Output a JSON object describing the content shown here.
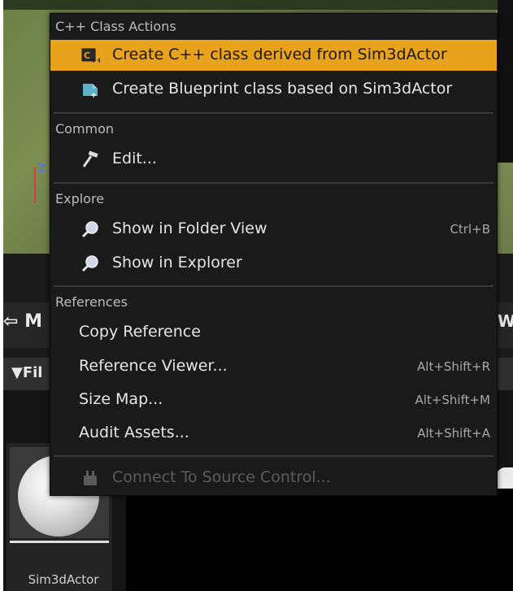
{
  "background": {
    "toolbar_text_left": "M",
    "toolbar_text_right": "W",
    "filters_label": "Fil",
    "asset_name": "Sim3dActor",
    "gizmo_z": "Z"
  },
  "menu": {
    "sections": {
      "cpp": "C++ Class Actions",
      "common": "Common",
      "explore": "Explore",
      "references": "References"
    },
    "items": {
      "create_cpp": {
        "label": "Create C++ class derived from Sim3dActor",
        "icon": "cpp-class-icon"
      },
      "create_blueprint": {
        "label": "Create Blueprint class based on Sim3dActor",
        "icon": "blueprint-icon"
      },
      "edit": {
        "label": "Edit...",
        "icon": "hammer-icon"
      },
      "folder_view": {
        "label": "Show in Folder View",
        "shortcut": "Ctrl+B",
        "icon": "magnifier-icon"
      },
      "explorer": {
        "label": "Show in Explorer",
        "icon": "magnifier-icon"
      },
      "copy_ref": {
        "label": "Copy Reference"
      },
      "ref_viewer": {
        "label": "Reference Viewer...",
        "shortcut": "Alt+Shift+R"
      },
      "size_map": {
        "label": "Size Map...",
        "shortcut": "Alt+Shift+M"
      },
      "audit": {
        "label": "Audit Assets...",
        "shortcut": "Alt+Shift+A"
      },
      "source_control": {
        "label": "Connect To Source Control...",
        "icon": "plug-icon",
        "disabled": true
      }
    }
  },
  "colors": {
    "highlight": "#e8a21c",
    "menu_bg": "#1a1a1a"
  }
}
